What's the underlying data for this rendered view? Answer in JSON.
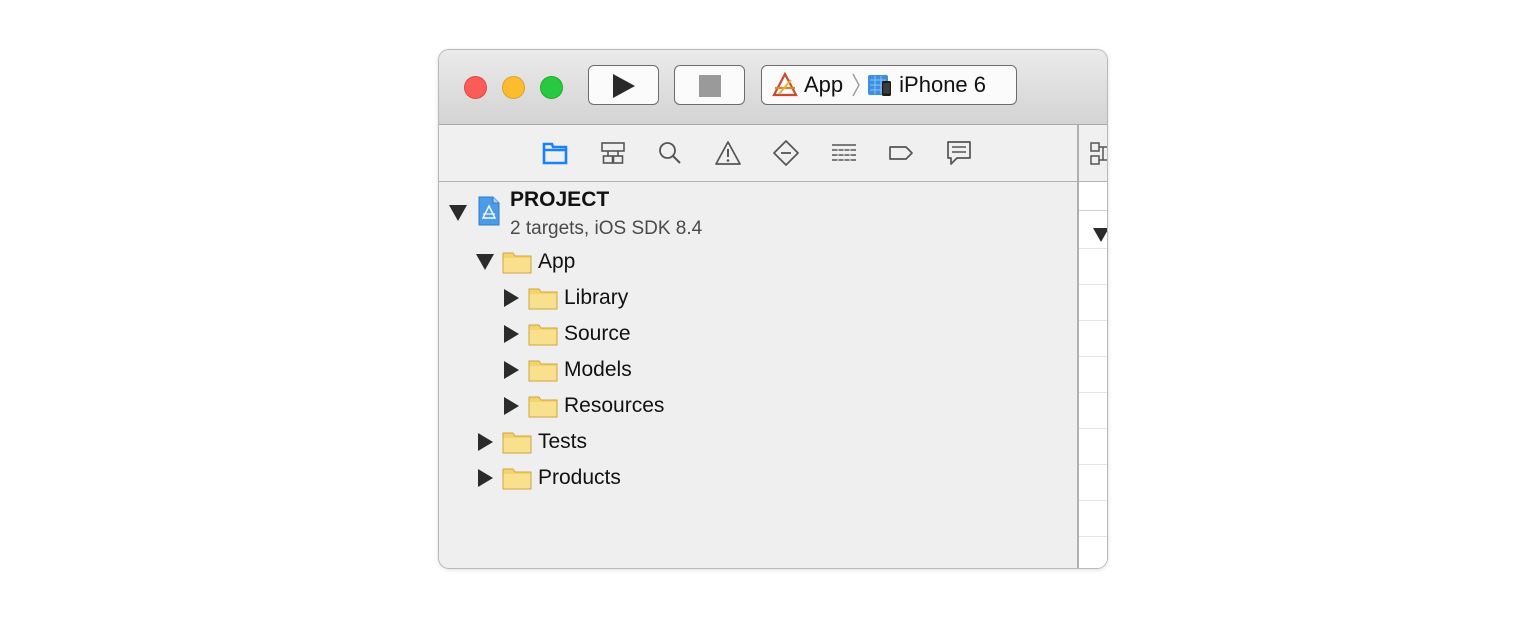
{
  "toolbar": {
    "run_icon": "play-icon",
    "stop_icon": "stop-icon",
    "scheme": {
      "target_label": "App",
      "device_label": "iPhone 6",
      "target_icon": "xcode-app-icon",
      "device_icon": "iphone-simulator-icon"
    }
  },
  "navigator": {
    "tabs": [
      {
        "icon": "folder-icon",
        "active": true
      },
      {
        "icon": "hierarchy-icon",
        "active": false
      },
      {
        "icon": "search-icon",
        "active": false
      },
      {
        "icon": "warning-icon",
        "active": false
      },
      {
        "icon": "test-diamond-icon",
        "active": false
      },
      {
        "icon": "debug-list-icon",
        "active": false
      },
      {
        "icon": "breakpoint-icon",
        "active": false
      },
      {
        "icon": "report-icon",
        "active": false
      }
    ],
    "accent_color": "#1a82f7"
  },
  "tree": {
    "project": {
      "name": "PROJECT",
      "subtitle": "2 targets, iOS SDK 8.4",
      "expanded": true
    },
    "items": [
      {
        "label": "App",
        "level": 1,
        "expanded": true
      },
      {
        "label": "Library",
        "level": 2,
        "expanded": false
      },
      {
        "label": "Source",
        "level": 2,
        "expanded": false
      },
      {
        "label": "Models",
        "level": 2,
        "expanded": false
      },
      {
        "label": "Resources",
        "level": 2,
        "expanded": false
      },
      {
        "label": "Tests",
        "level": 1,
        "expanded": false
      },
      {
        "label": "Products",
        "level": 1,
        "expanded": false
      }
    ]
  }
}
